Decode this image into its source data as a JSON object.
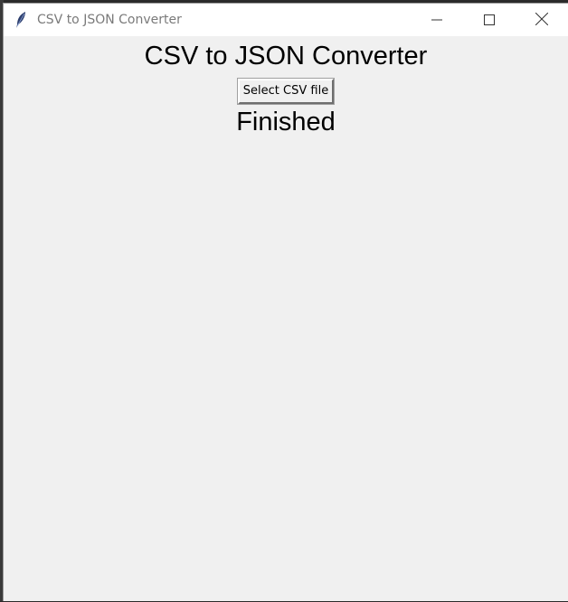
{
  "window": {
    "title": "CSV to JSON Converter",
    "icons": {
      "app": "tk-feather-icon",
      "minimize": "minimize-icon",
      "maximize": "maximize-icon",
      "close": "close-icon"
    }
  },
  "main": {
    "heading": "CSV to JSON Converter",
    "select_button_label": "Select CSV file",
    "status": "Finished"
  },
  "colors": {
    "client_background": "#f0f0f0",
    "titlebar_background": "#ffffff",
    "title_text": "#7a7a7a"
  }
}
